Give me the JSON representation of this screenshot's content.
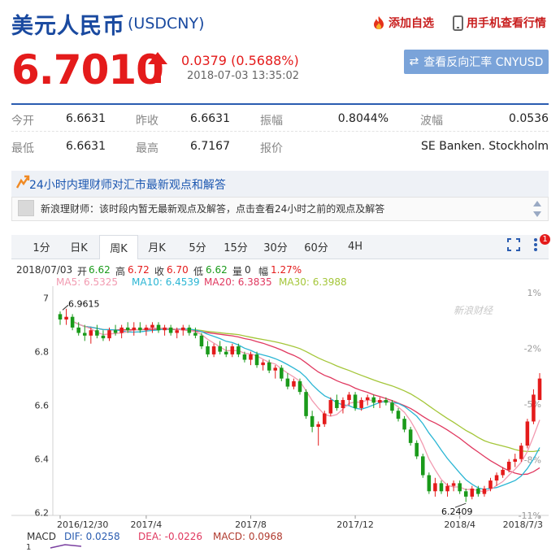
{
  "header": {
    "name": "美元人民币",
    "code": "(USDCNY)",
    "add_watch": "添加自选",
    "mobile_view": "用手机查看行情"
  },
  "quote": {
    "price": "6.7010",
    "change": "0.0379 (0.5688%)",
    "time": "2018-07-03 13:35:02",
    "reverse_button": "查看反向汇率 CNYUSD"
  },
  "stats": {
    "open_label": "今开",
    "open": "6.6631",
    "prev_label": "昨收",
    "prev": "6.6631",
    "amp_label": "振幅",
    "amp": "0.8044%",
    "wave_label": "波幅",
    "wave": "0.0536",
    "low_label": "最低",
    "low": "6.6631",
    "high_label": "最高",
    "high": "6.7167",
    "quote_label": "报价",
    "quote": "SE Banken. Stockholm"
  },
  "advisor": {
    "title": "24小时内理财师对汇市最新观点和解答",
    "message": "新浪理财师：该时段内暂无最新观点及解答，点击查看24小时之前的观点及解答"
  },
  "chart_tabs": {
    "items": [
      "1分",
      "日K",
      "周K",
      "月K",
      "5分",
      "15分",
      "30分",
      "60分",
      "4H"
    ],
    "active": "周K",
    "alert_count": "1"
  },
  "ohlc_line": {
    "date": "2018/07/03",
    "open_label": "开",
    "open": "6.62",
    "high_label": "高",
    "high": "6.72",
    "close_label": "收",
    "close": "6.70",
    "low_label": "低",
    "low": "6.62",
    "vol_label": "量",
    "vol": "0",
    "amp_label": "幅",
    "amp": "1.27%"
  },
  "ma_line": {
    "ma5": "MA5: 6.5325",
    "ma10": "MA10: 6.4539",
    "ma20": "MA20: 6.3835",
    "ma30": "MA30: 6.3988"
  },
  "macd_line": {
    "label": "MACD",
    "dif": "DIF: 0.0258",
    "dea": "DEA: -0.0226",
    "macd": "MACD: 0.0968"
  },
  "watermark": "新浪财经",
  "colors": {
    "up": "#e41b1b",
    "down": "#1a9a1a",
    "ma5": "#f29ab0",
    "ma10": "#2bb6d4",
    "ma20": "#e0385f",
    "ma30": "#a4c639",
    "brand_blue": "#1a4aa0"
  },
  "chart_data": {
    "type": "candlestick",
    "ylim": [
      6.19,
      7.02
    ],
    "y_ticks": [
      "7",
      "6.8",
      "6.6",
      "6.4",
      "6.2"
    ],
    "y_tick_values": [
      7.0,
      6.8,
      6.6,
      6.4,
      6.2
    ],
    "pct_ticks": [
      "1%",
      "-2%",
      "-5%",
      "-8%",
      "-11%"
    ],
    "pct_tick_values": [
      0.01,
      -0.02,
      -0.05,
      -0.08,
      -0.11
    ],
    "x_ticks": [
      "2016/12/30",
      "2017/4",
      "2017/8",
      "2017/12",
      "2018/4",
      "2018/7/3"
    ],
    "max_label": "6.9615",
    "min_label": "6.2409",
    "ohlc": [
      [
        6.94,
        6.95,
        6.9,
        6.92
      ],
      [
        6.92,
        6.96,
        6.9,
        6.93
      ],
      [
        6.93,
        6.94,
        6.88,
        6.89
      ],
      [
        6.89,
        6.91,
        6.86,
        6.87
      ],
      [
        6.87,
        6.9,
        6.84,
        6.86
      ],
      [
        6.86,
        6.89,
        6.83,
        6.88
      ],
      [
        6.88,
        6.9,
        6.85,
        6.86
      ],
      [
        6.86,
        6.88,
        6.84,
        6.85
      ],
      [
        6.85,
        6.89,
        6.84,
        6.88
      ],
      [
        6.88,
        6.9,
        6.86,
        6.87
      ],
      [
        6.87,
        6.9,
        6.85,
        6.89
      ],
      [
        6.89,
        6.91,
        6.87,
        6.88
      ],
      [
        6.88,
        6.91,
        6.86,
        6.89
      ],
      [
        6.89,
        6.91,
        6.87,
        6.88
      ],
      [
        6.88,
        6.9,
        6.86,
        6.89
      ],
      [
        6.89,
        6.91,
        6.87,
        6.9
      ],
      [
        6.9,
        6.91,
        6.87,
        6.88
      ],
      [
        6.88,
        6.9,
        6.86,
        6.89
      ],
      [
        6.89,
        6.9,
        6.86,
        6.87
      ],
      [
        6.87,
        6.89,
        6.85,
        6.88
      ],
      [
        6.88,
        6.9,
        6.86,
        6.89
      ],
      [
        6.89,
        6.9,
        6.86,
        6.87
      ],
      [
        6.87,
        6.89,
        6.85,
        6.86
      ],
      [
        6.86,
        6.87,
        6.81,
        6.82
      ],
      [
        6.82,
        6.84,
        6.78,
        6.79
      ],
      [
        6.79,
        6.83,
        6.78,
        6.82
      ],
      [
        6.82,
        6.84,
        6.79,
        6.8
      ],
      [
        6.8,
        6.82,
        6.78,
        6.79
      ],
      [
        6.79,
        6.83,
        6.78,
        6.82
      ],
      [
        6.82,
        6.83,
        6.78,
        6.79
      ],
      [
        6.79,
        6.8,
        6.76,
        6.77
      ],
      [
        6.77,
        6.8,
        6.75,
        6.79
      ],
      [
        6.79,
        6.8,
        6.74,
        6.75
      ],
      [
        6.75,
        6.77,
        6.73,
        6.76
      ],
      [
        6.76,
        6.77,
        6.72,
        6.73
      ],
      [
        6.73,
        6.75,
        6.7,
        6.74
      ],
      [
        6.74,
        6.75,
        6.69,
        6.7
      ],
      [
        6.7,
        6.72,
        6.66,
        6.67
      ],
      [
        6.67,
        6.7,
        6.66,
        6.69
      ],
      [
        6.69,
        6.7,
        6.64,
        6.65
      ],
      [
        6.65,
        6.66,
        6.55,
        6.56
      ],
      [
        6.56,
        6.58,
        6.5,
        6.52
      ],
      [
        6.52,
        6.54,
        6.45,
        6.53
      ],
      [
        6.53,
        6.58,
        6.52,
        6.57
      ],
      [
        6.57,
        6.63,
        6.56,
        6.62
      ],
      [
        6.62,
        6.64,
        6.58,
        6.59
      ],
      [
        6.59,
        6.63,
        6.57,
        6.62
      ],
      [
        6.62,
        6.65,
        6.6,
        6.64
      ],
      [
        6.64,
        6.65,
        6.58,
        6.59
      ],
      [
        6.59,
        6.63,
        6.58,
        6.62
      ],
      [
        6.62,
        6.64,
        6.6,
        6.63
      ],
      [
        6.63,
        6.64,
        6.59,
        6.61
      ],
      [
        6.61,
        6.63,
        6.59,
        6.62
      ],
      [
        6.62,
        6.63,
        6.6,
        6.61
      ],
      [
        6.61,
        6.62,
        6.57,
        6.58
      ],
      [
        6.58,
        6.59,
        6.54,
        6.55
      ],
      [
        6.55,
        6.56,
        6.5,
        6.51
      ],
      [
        6.51,
        6.52,
        6.45,
        6.46
      ],
      [
        6.46,
        6.47,
        6.4,
        6.41
      ],
      [
        6.41,
        6.42,
        6.33,
        6.34
      ],
      [
        6.34,
        6.35,
        6.27,
        6.28
      ],
      [
        6.28,
        6.33,
        6.26,
        6.31
      ],
      [
        6.31,
        6.32,
        6.27,
        6.28
      ],
      [
        6.28,
        6.31,
        6.26,
        6.3
      ],
      [
        6.3,
        6.32,
        6.28,
        6.31
      ],
      [
        6.31,
        6.32,
        6.27,
        6.28
      ],
      [
        6.28,
        6.29,
        6.24,
        6.26
      ],
      [
        6.26,
        6.3,
        6.25,
        6.29
      ],
      [
        6.29,
        6.3,
        6.26,
        6.27
      ],
      [
        6.27,
        6.3,
        6.26,
        6.29
      ],
      [
        6.29,
        6.33,
        6.28,
        6.32
      ],
      [
        6.32,
        6.35,
        6.3,
        6.34
      ],
      [
        6.34,
        6.37,
        6.33,
        6.36
      ],
      [
        6.36,
        6.4,
        6.35,
        6.39
      ],
      [
        6.39,
        6.42,
        6.37,
        6.4
      ],
      [
        6.4,
        6.46,
        6.39,
        6.45
      ],
      [
        6.45,
        6.55,
        6.44,
        6.54
      ],
      [
        6.54,
        6.66,
        6.53,
        6.64
      ],
      [
        6.62,
        6.72,
        6.62,
        6.7
      ]
    ]
  }
}
